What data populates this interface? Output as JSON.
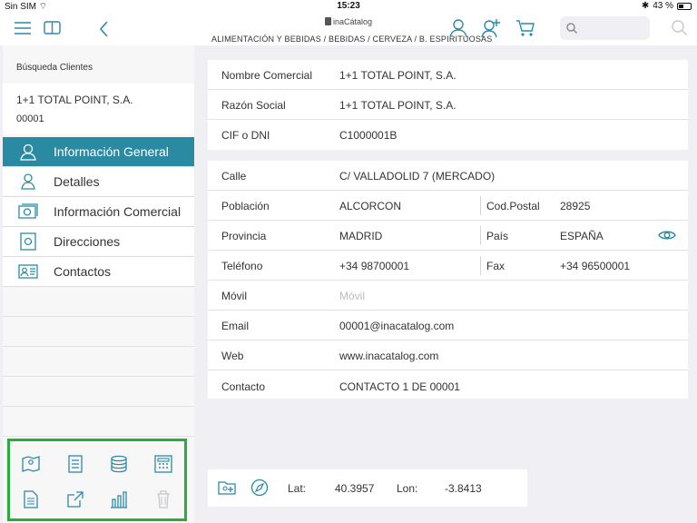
{
  "status": {
    "carrier": "Sin SIM",
    "time": "15:23",
    "battery": "43 %"
  },
  "header": {
    "app_name": "inaCátalog",
    "breadcrumb": "ALIMENTACIÓN Y BEBIDAS / BEBIDAS / CERVEZA / B. ESPIRITUOSAS"
  },
  "sidebar": {
    "title": "Búsqueda Clientes",
    "client_name": "1+1 TOTAL POINT, S.A.",
    "client_code": "00001",
    "items": [
      {
        "label": "Información General",
        "icon": "person-outline-icon"
      },
      {
        "label": "Detalles",
        "icon": "person-icon"
      },
      {
        "label": "Información Comercial",
        "icon": "money-icon"
      },
      {
        "label": "Direcciones",
        "icon": "address-card-icon"
      },
      {
        "label": "Contactos",
        "icon": "contact-card-icon"
      }
    ]
  },
  "identity": [
    {
      "label": "Nombre Comercial",
      "value": "1+1 TOTAL POINT, S.A."
    },
    {
      "label": "Razón Social",
      "value": "1+1 TOTAL POINT, S.A."
    },
    {
      "label": "CIF o DNI",
      "value": "C1000001B"
    }
  ],
  "address": {
    "calle": {
      "label": "Calle",
      "value": "C/ VALLADOLID 7 (MERCADO)"
    },
    "poblacion": {
      "label": "Población",
      "value": "ALCORCON",
      "label2": "Cod.Postal",
      "value2": "28925"
    },
    "provincia": {
      "label": "Provincia",
      "value": "MADRID",
      "label2": "País",
      "value2": "ESPAÑA"
    },
    "telefono": {
      "label": "Teléfono",
      "value": "+34 98700001",
      "label2": "Fax",
      "value2": "+34 96500001"
    },
    "movil": {
      "label": "Móvil",
      "placeholder": "Móvil"
    },
    "email": {
      "label": "Email",
      "value": "00001@inacatalog.com"
    },
    "web": {
      "label": "Web",
      "value": "www.inacatalog.com"
    },
    "contacto": {
      "label": "Contacto",
      "value": "CONTACTO 1 DE 00001"
    }
  },
  "location": {
    "lat_label": "Lat:",
    "lat": "40.3957",
    "lon_label": "Lon:",
    "lon": "-3.8413"
  },
  "colors": {
    "accent": "#2a8aa1",
    "highlight_box": "#27ae3a"
  }
}
